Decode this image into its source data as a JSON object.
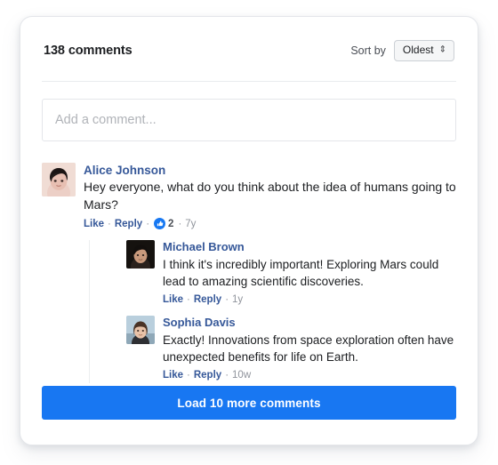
{
  "header": {
    "comments_count_label": "138 comments",
    "sort_label": "Sort by",
    "sort_value": "Oldest",
    "sort_arrows_glyph": "⇕"
  },
  "composer": {
    "placeholder": "Add a comment...",
    "value": ""
  },
  "thread": {
    "root": {
      "author": "Alice Johnson",
      "avatar_name": "avatar-alice-johnson",
      "text": "Hey everyone, what do you think about the idea of humans going to Mars?",
      "like_label": "Like",
      "reply_label": "Reply",
      "separator": "·",
      "reaction_count": "2",
      "timestamp": "7y"
    },
    "replies": [
      {
        "author": "Michael Brown",
        "avatar_name": "avatar-michael-brown",
        "text": "I think it's incredibly important! Exploring Mars could lead to amazing scientific discoveries.",
        "like_label": "Like",
        "reply_label": "Reply",
        "separator": "·",
        "timestamp": "1y"
      },
      {
        "author": "Sophia Davis",
        "avatar_name": "avatar-sophia-davis",
        "text": "Exactly! Innovations from space exploration often have unexpected benefits for life on Earth.",
        "like_label": "Like",
        "reply_label": "Reply",
        "separator": "·",
        "timestamp": "10w"
      }
    ]
  },
  "footer": {
    "load_more_label": "Load 10 more comments"
  },
  "colors": {
    "accent_blue": "#1877f2",
    "link_blue": "#365899",
    "text_dark": "#1c1e21",
    "text_muted": "#90949c",
    "border": "#e4e6ea"
  }
}
